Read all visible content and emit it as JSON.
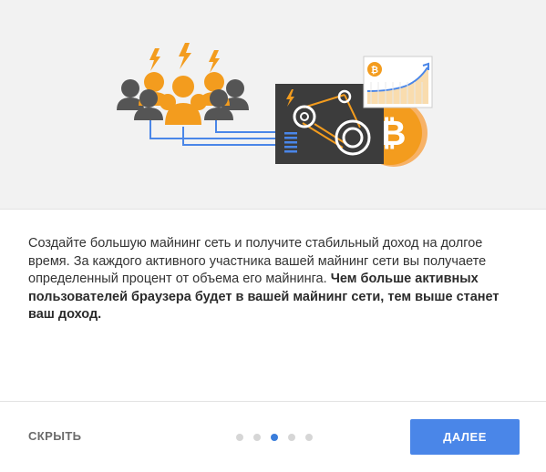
{
  "illustration": {
    "icons": [
      "lightning-icon",
      "people-group-icon",
      "mining-machine-icon",
      "bitcoin-coin-icon",
      "growth-chart-icon"
    ],
    "colors": {
      "orange": "#f39c1e",
      "grey": "#555555",
      "dark": "#3c3c3c",
      "blue": "#4a86e8"
    }
  },
  "description": {
    "text_regular": "Создайте большую майнинг сеть и получите стабильный доход на долгое время. За каждого активного участника вашей майнинг сети вы получаете определенный процент от объема его майнинга. ",
    "text_bold": "Чем больше активных пользователей браузера будет в вашей майнинг сети, тем выше станет ваш доход."
  },
  "footer": {
    "skip_label": "СКРЫТЬ",
    "next_label": "ДАЛЕЕ",
    "pagination": {
      "total": 5,
      "active": 3
    },
    "colors": {
      "primary": "#4a86e8",
      "dot_active": "#3a7ddb",
      "dot_inactive": "#d6d6d6"
    }
  }
}
